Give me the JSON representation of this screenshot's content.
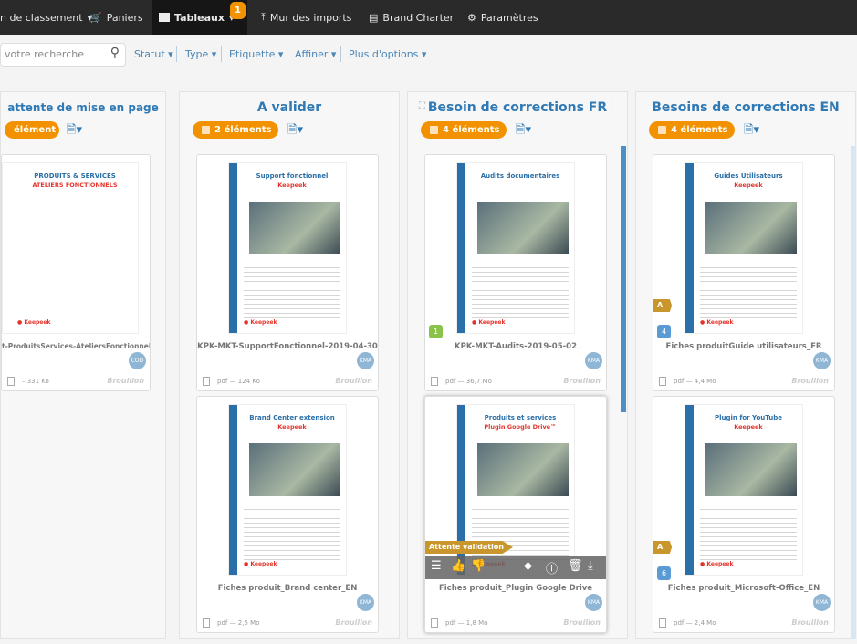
{
  "nav": {
    "items": [
      {
        "label": "n de classement",
        "icon": "caret"
      },
      {
        "label": "Paniers",
        "icon": "cart-icon"
      },
      {
        "label": "Tableaux",
        "icon": "board-icon",
        "active": true,
        "badge": "1"
      },
      {
        "label": "Mur des imports",
        "icon": "upload-icon"
      },
      {
        "label": "Brand Charter",
        "icon": "charter-icon"
      },
      {
        "label": "Paramètres",
        "icon": "gear-icon"
      }
    ]
  },
  "filters": {
    "search_placeholder": "votre recherche",
    "items": [
      "Statut",
      "Type",
      "Etiquette",
      "Affiner",
      "Plus d'options"
    ]
  },
  "columns": [
    {
      "title": "attente de mise en page",
      "count": "élément",
      "cards": [
        {
          "name": "t-ProduitsServices-AteliersFonctionnels",
          "avatar": "COD",
          "size": "– 331 Ko",
          "state": "Brouillon",
          "t1": "PRODUITS & SERVICES",
          "t2": "ATELIERS FONCTIONNELS"
        }
      ]
    },
    {
      "title": "A valider",
      "count": "2 éléments",
      "cards": [
        {
          "name": "KPK-MKT-SupportFonctionnel-2019-04-30",
          "avatar": "KMA",
          "size": "pdf — 124 Ko",
          "state": "Brouillon",
          "t1": "Support fonctionnel",
          "t2": "Keepeek"
        },
        {
          "name": "Fiches produit_Brand center_EN",
          "avatar": "KMA",
          "size": "pdf — 2,5 Mo",
          "state": "Brouillon",
          "t1": "Brand Center extension",
          "t2": "Keepeek"
        }
      ]
    },
    {
      "title": "Besoin de corrections FR",
      "count": "4 éléments",
      "cards": [
        {
          "name": "KPK-MKT-Audits-2019-05-02",
          "avatar": "KMA",
          "size": "pdf — 36,7 Mo",
          "state": "Brouillon",
          "t1": "Audits documentaires",
          "t2": "",
          "number": "1"
        },
        {
          "name": "Fiches produit_Plugin Google Drive",
          "avatar": "KMA",
          "size": "pdf — 1,8 Mo",
          "state": "Brouillon",
          "t1": "Produits et services",
          "t2": "Plugin Google Drive™",
          "label": "Attente validation",
          "hover": true
        }
      ]
    },
    {
      "title": "Besoins de corrections EN",
      "count": "4 éléments",
      "cards": [
        {
          "name": "Fiches produitGuide utilisateurs_FR",
          "avatar": "KMA",
          "size": "pdf — 4,4 Mo",
          "state": "Brouillon",
          "t1": "Guides Utilisateurs",
          "t2": "Keepeek",
          "label": "A",
          "number": "4"
        },
        {
          "name": "Fiches produit_Microsoft-Office_EN",
          "avatar": "KMA",
          "size": "pdf — 2,4 Mo",
          "state": "Brouillon",
          "t1": "Plugin for YouTube",
          "t2": "Keepeek",
          "label": "A",
          "number": "6"
        }
      ]
    }
  ],
  "colors": {
    "accent": "#f39200",
    "blue": "#2f79b5",
    "topbar": "#2a2a2a"
  }
}
